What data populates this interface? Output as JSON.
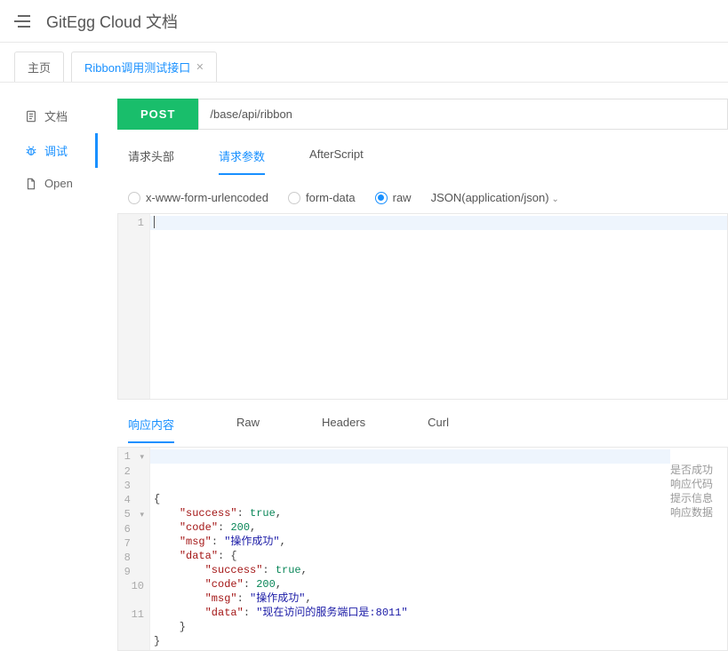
{
  "app_title": "GitEgg Cloud 文档",
  "top_tabs": [
    {
      "label": "主页",
      "active": false
    },
    {
      "label": "Ribbon调用测试接口",
      "active": true,
      "closeable": true
    }
  ],
  "sidebar": [
    {
      "label": "文档",
      "icon": "doc",
      "active": false
    },
    {
      "label": "调试",
      "icon": "bug",
      "active": true
    },
    {
      "label": "Open",
      "icon": "page",
      "active": false
    }
  ],
  "request": {
    "method": "POST",
    "url": "/base/api/ribbon"
  },
  "req_tabs": [
    {
      "label": "请求头部",
      "active": false
    },
    {
      "label": "请求参数",
      "active": true
    },
    {
      "label": "AfterScript",
      "active": false
    }
  ],
  "body_types": [
    {
      "label": "x-www-form-urlencoded",
      "checked": false
    },
    {
      "label": "form-data",
      "checked": false
    },
    {
      "label": "raw",
      "checked": true
    }
  ],
  "content_type_label": "JSON(application/json)",
  "req_editor_lines": [
    "1"
  ],
  "resp_tabs": [
    {
      "label": "响应内容",
      "active": true
    },
    {
      "label": "Raw",
      "active": false
    },
    {
      "label": "Headers",
      "active": false
    },
    {
      "label": "Curl",
      "active": false
    }
  ],
  "resp_json": {
    "lines": [
      {
        "n": 1,
        "fold": "▾",
        "indent": 0,
        "tokens": [
          {
            "t": "plain",
            "v": "{"
          }
        ]
      },
      {
        "n": 2,
        "indent": 1,
        "tokens": [
          {
            "t": "key",
            "v": "\"success\""
          },
          {
            "t": "plain",
            "v": ": "
          },
          {
            "t": "bool",
            "v": "true"
          },
          {
            "t": "plain",
            "v": ","
          }
        ]
      },
      {
        "n": 3,
        "indent": 1,
        "tokens": [
          {
            "t": "key",
            "v": "\"code\""
          },
          {
            "t": "plain",
            "v": ": "
          },
          {
            "t": "num",
            "v": "200"
          },
          {
            "t": "plain",
            "v": ","
          }
        ]
      },
      {
        "n": 4,
        "indent": 1,
        "tokens": [
          {
            "t": "key",
            "v": "\"msg\""
          },
          {
            "t": "plain",
            "v": ": "
          },
          {
            "t": "str",
            "v": "\"操作成功\""
          },
          {
            "t": "plain",
            "v": ","
          }
        ]
      },
      {
        "n": 5,
        "fold": "▾",
        "indent": 1,
        "tokens": [
          {
            "t": "key",
            "v": "\"data\""
          },
          {
            "t": "plain",
            "v": ": {"
          }
        ]
      },
      {
        "n": 6,
        "indent": 2,
        "tokens": [
          {
            "t": "key",
            "v": "\"success\""
          },
          {
            "t": "plain",
            "v": ": "
          },
          {
            "t": "bool",
            "v": "true"
          },
          {
            "t": "plain",
            "v": ","
          }
        ]
      },
      {
        "n": 7,
        "indent": 2,
        "tokens": [
          {
            "t": "key",
            "v": "\"code\""
          },
          {
            "t": "plain",
            "v": ": "
          },
          {
            "t": "num",
            "v": "200"
          },
          {
            "t": "plain",
            "v": ","
          }
        ]
      },
      {
        "n": 8,
        "indent": 2,
        "tokens": [
          {
            "t": "key",
            "v": "\"msg\""
          },
          {
            "t": "plain",
            "v": ": "
          },
          {
            "t": "str",
            "v": "\"操作成功\""
          },
          {
            "t": "plain",
            "v": ","
          }
        ]
      },
      {
        "n": 9,
        "indent": 2,
        "tokens": [
          {
            "t": "key",
            "v": "\"data\""
          },
          {
            "t": "plain",
            "v": ": "
          },
          {
            "t": "str",
            "v": "\"现在访问的服务端口是:8011\""
          }
        ]
      },
      {
        "n": 10,
        "indent": 1,
        "tokens": [
          {
            "t": "plain",
            "v": "}"
          }
        ]
      },
      {
        "n": 11,
        "indent": 0,
        "tokens": [
          {
            "t": "plain",
            "v": "}"
          }
        ]
      }
    ]
  },
  "annotations": [
    "是否成功",
    "响应代码",
    "提示信息",
    "响应数据"
  ]
}
